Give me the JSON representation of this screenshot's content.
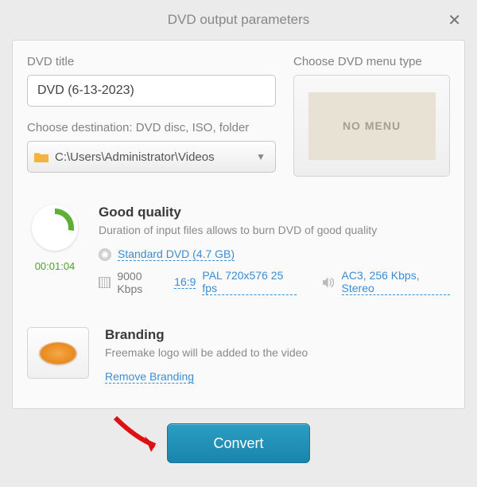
{
  "titlebar": {
    "text": "DVD output parameters"
  },
  "dvdTitle": {
    "label": "DVD title",
    "value": "DVD (6-13-2023)"
  },
  "destination": {
    "label": "Choose destination: DVD disc, ISO, folder",
    "value": "C:\\Users\\Administrator\\Videos"
  },
  "menuType": {
    "label": "Choose DVD menu type",
    "preview": "NO MENU"
  },
  "quality": {
    "title": "Good quality",
    "subtitle": "Duration of input files allows to burn DVD of good quality",
    "duration": "00:01:04",
    "disc_link": "Standard DVD (4.7 GB)",
    "bitrate": "9000 Kbps",
    "aspect_link": "16:9",
    "format_link": "PAL 720x576 25 fps",
    "audio_link": "AC3, 256 Kbps, Stereo"
  },
  "branding": {
    "title": "Branding",
    "subtitle": "Freemake logo will be added to the video",
    "remove_link": "Remove Branding"
  },
  "convert": {
    "label": "Convert"
  }
}
